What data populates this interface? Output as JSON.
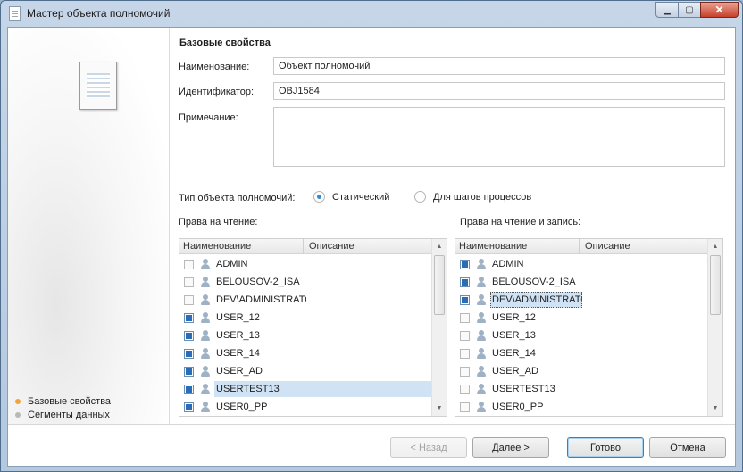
{
  "window": {
    "title": "Мастер объекта полномочий",
    "controls": {
      "minimize": "▁",
      "maximize": "▢",
      "close": "✕"
    }
  },
  "steps": [
    {
      "label": "Базовые свойства",
      "active": true
    },
    {
      "label": "Сегменты данных",
      "active": false
    }
  ],
  "form": {
    "section_title": "Базовые свойства",
    "name_label": "Наименование:",
    "name_value": "Объект полномочий",
    "id_label": "Идентификатор:",
    "id_value": "OBJ1584",
    "note_label": "Примечание:",
    "note_value": "",
    "type_label": "Тип объекта полномочий:",
    "type_options": [
      {
        "label": "Статический",
        "selected": true
      },
      {
        "label": "Для шагов процессов",
        "selected": false
      }
    ]
  },
  "read_rights": {
    "label": "Права на чтение:",
    "columns": [
      "Наименование",
      "Описание"
    ],
    "rows": [
      {
        "name": "ADMIN",
        "checked": false
      },
      {
        "name": "BELOUSOV-2_ISA",
        "checked": false
      },
      {
        "name": "DEV\\ADMINISTRATOR",
        "checked": false
      },
      {
        "name": "USER_12",
        "checked": true
      },
      {
        "name": "USER_13",
        "checked": true
      },
      {
        "name": "USER_14",
        "checked": true
      },
      {
        "name": "USER_AD",
        "checked": true
      },
      {
        "name": "USERTEST13",
        "checked": true
      },
      {
        "name": "USER0_PP",
        "checked": true
      }
    ]
  },
  "write_rights": {
    "label": "Права на чтение и запись:",
    "columns": [
      "Наименование",
      "Описание"
    ],
    "rows": [
      {
        "name": "ADMIN",
        "checked": true
      },
      {
        "name": "BELOUSOV-2_ISA",
        "checked": true
      },
      {
        "name": "DEV\\ADMINISTRATOR",
        "checked": true
      },
      {
        "name": "USER_12",
        "checked": false
      },
      {
        "name": "USER_13",
        "checked": false
      },
      {
        "name": "USER_14",
        "checked": false
      },
      {
        "name": "USER_AD",
        "checked": false
      },
      {
        "name": "USERTEST13",
        "checked": false
      },
      {
        "name": "USER0_PP",
        "checked": false
      }
    ]
  },
  "buttons": {
    "back": "< Назад",
    "next": "Далее >",
    "finish": "Готово",
    "cancel": "Отмена"
  },
  "colors": {
    "accent": "#2a6cb5",
    "step_active": "#f2a33a",
    "selection": "#cfe3f5"
  }
}
